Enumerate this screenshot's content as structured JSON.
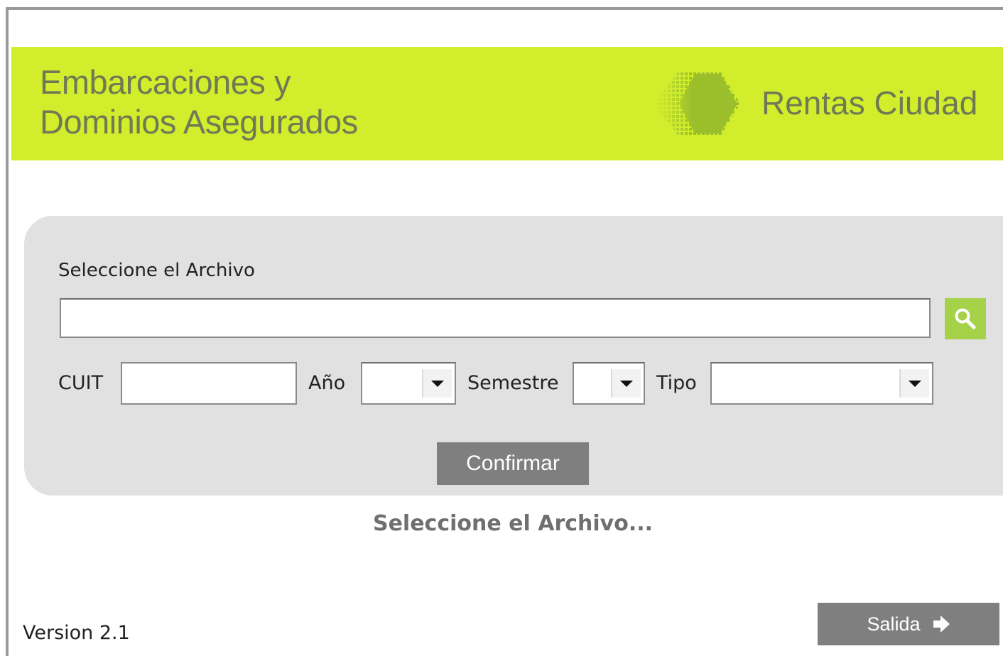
{
  "header": {
    "title_line1": "Embarcaciones y",
    "title_line2": "Dominios Asegurados",
    "brand": "Rentas Ciudad",
    "logo_icon": "hexagon-logo-icon"
  },
  "form": {
    "file_label": "Seleccione el Archivo",
    "file_value": "",
    "search_icon": "search-icon",
    "cuit_label": "CUIT",
    "cuit_value": "",
    "year_label": "Año",
    "year_value": "",
    "semester_label": "Semestre",
    "semester_value": "",
    "type_label": "Tipo",
    "type_value": "",
    "confirm_label": "Confirmar"
  },
  "status": {
    "message": "Seleccione el Archivo..."
  },
  "footer": {
    "version": "Version 2.1",
    "exit_label": "Salida",
    "exit_icon": "arrow-right-icon"
  },
  "colors": {
    "header_bg": "#d2ed2c",
    "header_text": "#6f7a55",
    "panel_bg": "#e1e1e1",
    "button_bg": "#7f7f7f",
    "search_bg": "#a6d24a"
  }
}
